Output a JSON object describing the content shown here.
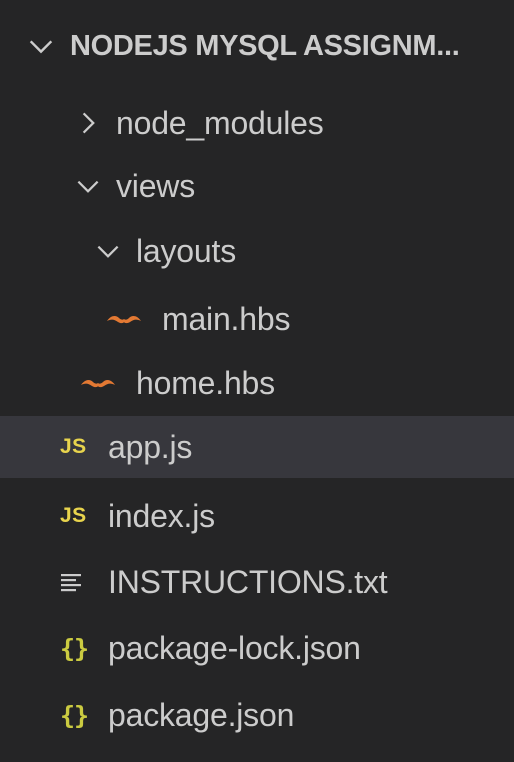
{
  "explorer": {
    "folder_title": "NODEJS MYSQL ASSIGNM...",
    "items": [
      {
        "label": "node_modules",
        "type": "folder",
        "expanded": false,
        "icon": "chevron-right-icon"
      },
      {
        "label": "views",
        "type": "folder",
        "expanded": true,
        "icon": "chevron-down-icon"
      },
      {
        "label": "layouts",
        "type": "folder",
        "expanded": true,
        "icon": "chevron-down-icon"
      },
      {
        "label": "main.hbs",
        "type": "file",
        "icon": "handlebars-icon"
      },
      {
        "label": "home.hbs",
        "type": "file",
        "icon": "handlebars-icon"
      },
      {
        "label": "app.js",
        "type": "file",
        "icon": "javascript-icon",
        "icon_text": "JS",
        "selected": true
      },
      {
        "label": "index.js",
        "type": "file",
        "icon": "javascript-icon",
        "icon_text": "JS"
      },
      {
        "label": "INSTRUCTIONS.txt",
        "type": "file",
        "icon": "text-file-icon"
      },
      {
        "label": "package-lock.json",
        "type": "file",
        "icon": "json-icon",
        "icon_text": "{}"
      },
      {
        "label": "package.json",
        "type": "file",
        "icon": "json-icon",
        "icon_text": "{}"
      }
    ]
  },
  "colors": {
    "background": "#252526",
    "text": "#cccccc",
    "selected_row": "#37373d",
    "js_icon": "#e8d44d",
    "json_icon": "#cbcb41",
    "handlebars_icon": "#e37933"
  }
}
